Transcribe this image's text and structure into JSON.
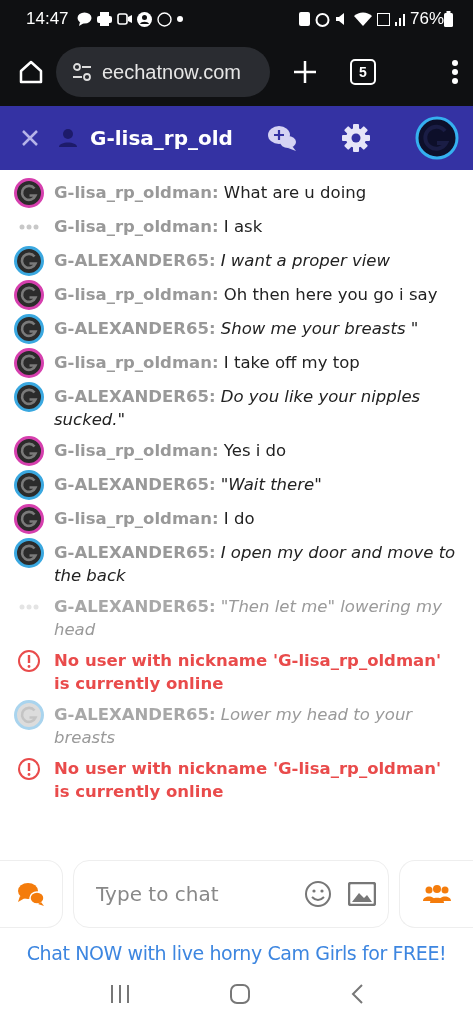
{
  "status_bar": {
    "time": "14:47",
    "battery": "76%"
  },
  "browser": {
    "url": "eechatnow.com",
    "tab_count": "5"
  },
  "header": {
    "title": "G-lisa_rp_old"
  },
  "messages": [
    {
      "kind": "message",
      "avatar": {
        "kind": "photo",
        "color": "#d63fae"
      },
      "name": "G-lisa_rp_oldman:",
      "text": "What are u doing",
      "italic": false,
      "faded": false
    },
    {
      "kind": "message",
      "avatar": {
        "kind": "typing"
      },
      "name": "G-lisa_rp_oldman:",
      "text": "I ask",
      "italic": false,
      "faded": false
    },
    {
      "kind": "message",
      "avatar": {
        "kind": "photo",
        "color": "#3aa8e0"
      },
      "name": "G-ALEXANDER65:",
      "text": "I want a proper view",
      "italic": true,
      "faded": false
    },
    {
      "kind": "message",
      "avatar": {
        "kind": "photo",
        "color": "#d63fae"
      },
      "name": "G-lisa_rp_oldman:",
      "text": "Oh then here you go i say",
      "italic": false,
      "faded": false
    },
    {
      "kind": "message",
      "avatar": {
        "kind": "photo",
        "color": "#3aa8e0"
      },
      "name": "G-ALEXANDER65:",
      "text": "Show me your breasts \"",
      "italic": true,
      "faded": false
    },
    {
      "kind": "message",
      "avatar": {
        "kind": "photo",
        "color": "#d63fae"
      },
      "name": "G-lisa_rp_oldman:",
      "text": "I take off my top",
      "italic": false,
      "faded": false
    },
    {
      "kind": "message",
      "avatar": {
        "kind": "photo",
        "color": "#3aa8e0"
      },
      "name": "G-ALEXANDER65:",
      "text": "Do you like your nipples sucked.\"",
      "italic": true,
      "faded": false
    },
    {
      "kind": "message",
      "avatar": {
        "kind": "photo",
        "color": "#d63fae"
      },
      "name": "G-lisa_rp_oldman:",
      "text": "Yes i do",
      "italic": false,
      "faded": false
    },
    {
      "kind": "message",
      "avatar": {
        "kind": "photo",
        "color": "#3aa8e0"
      },
      "name": "G-ALEXANDER65:",
      "text": "\"Wait there\"",
      "italic": true,
      "faded": false
    },
    {
      "kind": "message",
      "avatar": {
        "kind": "photo",
        "color": "#d63fae"
      },
      "name": "G-lisa_rp_oldman:",
      "text": "I do",
      "italic": false,
      "faded": false
    },
    {
      "kind": "message",
      "avatar": {
        "kind": "photo",
        "color": "#3aa8e0"
      },
      "name": "G-ALEXANDER65:",
      "text": "I open my door and move to the back",
      "italic": true,
      "faded": false
    },
    {
      "kind": "message",
      "avatar": {
        "kind": "typing"
      },
      "name": "G-ALEXANDER65:",
      "text": "\"Then let me\" lowering my head",
      "italic": true,
      "faded": true
    },
    {
      "kind": "error",
      "text": "No user with nickname 'G-lisa_rp_oldman' is currently online"
    },
    {
      "kind": "message",
      "avatar": {
        "kind": "photo",
        "color": "#a9d4ee"
      },
      "name": "G-ALEXANDER65:",
      "text": "Lower my head to your breasts",
      "italic": true,
      "faded": true
    },
    {
      "kind": "error",
      "text": "No user with nickname 'G-lisa_rp_oldman' is currently online"
    }
  ],
  "composer": {
    "placeholder": "Type to chat"
  },
  "promo": "Chat NOW with live horny Cam Girls for FREE!"
}
